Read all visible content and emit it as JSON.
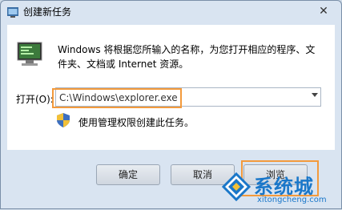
{
  "window": {
    "title": "创建新任务",
    "close_glyph": "✕"
  },
  "main": {
    "description": "Windows 将根据您所输入的名称，为您打开相应的程序、文件夹、文档或 Internet 资源。",
    "open_label": "打开(O):",
    "open_value": "C:\\Windows\\explorer.exe",
    "admin_checkbox_label": "使用管理权限创建此任务。"
  },
  "buttons": {
    "ok": "确定",
    "cancel": "取消",
    "browse": "浏览"
  },
  "watermark": {
    "brand": "系统城",
    "url": "xitongcheng.com"
  },
  "colors": {
    "highlight": "#f39a3c",
    "brand_blue": "#1a77c9"
  },
  "icons": [
    "app-icon",
    "run-program-icon",
    "dropdown-arrow-icon",
    "uac-shield-icon",
    "close-icon",
    "watermark-logo-icon"
  ]
}
